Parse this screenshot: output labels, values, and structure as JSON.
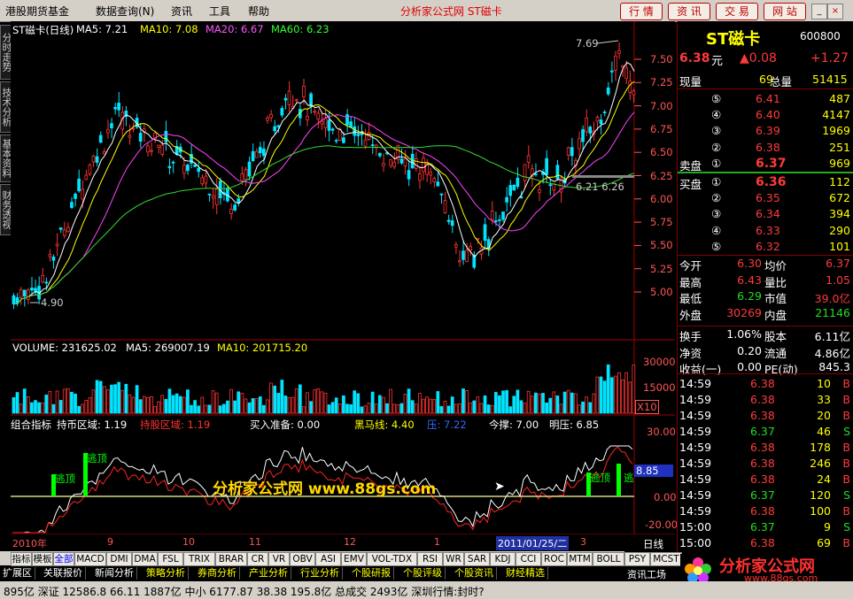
{
  "menu": [
    "港股期货基金",
    "数据查询(N)",
    "资讯",
    "工具",
    "帮助"
  ],
  "window_title": "分析家公式网 ST磁卡",
  "top_buttons": [
    "行 情",
    "资 讯",
    "交 易",
    "网 站"
  ],
  "window_controls": [
    "_",
    "□",
    "×"
  ],
  "left_tabs": [
    "分时走势",
    "技术分析",
    "基本资料",
    "财务透视"
  ],
  "main_header": {
    "name": "ST磁卡(日线)",
    "ma5": "MA5: 7.21",
    "ma10": "MA10: 7.08",
    "ma20": "MA20: 6.67",
    "ma60": "MA60: 6.23"
  },
  "price_axis": [
    "7.50",
    "7.25",
    "7.00",
    "6.75",
    "6.50",
    "6.25",
    "6.00",
    "5.75",
    "5.50",
    "5.25",
    "5.00"
  ],
  "annotations": {
    "high": "7.69",
    "low": "4.90",
    "mid": "6.21 6.26"
  },
  "volume_header": {
    "volume": "VOLUME: 231625.02",
    "ma5": "MA5: 269007.19",
    "ma10": "MA10: 201715.20"
  },
  "volume_axis": [
    "30000",
    "15000",
    "X10"
  ],
  "indicator_header": {
    "name": "组合指标",
    "a": "持币区域: 1.19",
    "b": "持股区域: 1.19",
    "c": "买入准备: 0.00",
    "d": "黑马线: 4.40",
    "e": "压: 7.22",
    "f": "今撑: 7.00",
    "g": "明压: 6.85"
  },
  "indicator_axis": [
    "30.00",
    "8.85",
    "0.00",
    "-20.00"
  ],
  "indicator_marks": [
    "逃顶",
    "逃顶",
    "逃顶",
    "逃"
  ],
  "watermark": "分析家公式网 www.88gs.com",
  "time_axis": [
    "2010年",
    "9",
    "10",
    "11",
    "12",
    "1",
    "2011/01/25/二",
    "3"
  ],
  "period": "日线",
  "stock": {
    "name": "ST磁卡",
    "code": "600800",
    "price": "6.38",
    "unit": "元",
    "change": "▲0.08",
    "change_pct": "+1.27"
  },
  "volume_info": {
    "now_label": "现量",
    "now_value": "69",
    "total_label": "总量",
    "total_value": "51415"
  },
  "sell_orders": [
    {
      "level": "⑤",
      "price": "6.41",
      "vol": "487"
    },
    {
      "level": "④",
      "price": "6.40",
      "vol": "4147"
    },
    {
      "level": "③",
      "price": "6.39",
      "vol": "1969"
    },
    {
      "level": "②",
      "price": "6.38",
      "vol": "251"
    },
    {
      "label": "卖盘",
      "level": "①",
      "price": "6.37",
      "vol": "969"
    }
  ],
  "buy_orders": [
    {
      "label": "买盘",
      "level": "①",
      "price": "6.36",
      "vol": "112"
    },
    {
      "level": "②",
      "price": "6.35",
      "vol": "672"
    },
    {
      "level": "③",
      "price": "6.34",
      "vol": "394"
    },
    {
      "level": "④",
      "price": "6.33",
      "vol": "290"
    },
    {
      "level": "⑤",
      "price": "6.32",
      "vol": "101"
    }
  ],
  "stats": [
    {
      "l1": "今开",
      "v1": "6.30",
      "l2": "均价",
      "v2": "6.37"
    },
    {
      "l1": "最高",
      "v1": "6.43",
      "l2": "量比",
      "v2": "1.05"
    },
    {
      "l1": "最低",
      "v1": "6.29",
      "l2": "市值",
      "v2": "39.0亿"
    },
    {
      "l1": "外盘",
      "v1": "30269",
      "l2": "内盘",
      "v2": "21146"
    }
  ],
  "stats2": [
    {
      "l1": "换手",
      "v1": "1.06%",
      "l2": "股本",
      "v2": "6.11亿"
    },
    {
      "l1": "净资",
      "v1": "0.20",
      "l2": "流通",
      "v2": "4.86亿"
    },
    {
      "l1": "收益(一)",
      "v1": "0.00",
      "l2": "PE(动)",
      "v2": "845.3"
    }
  ],
  "ticks": [
    {
      "t": "14:59",
      "p": "6.38",
      "v": "10",
      "s": "B"
    },
    {
      "t": "14:59",
      "p": "6.38",
      "v": "33",
      "s": "B"
    },
    {
      "t": "14:59",
      "p": "6.38",
      "v": "20",
      "s": "B"
    },
    {
      "t": "14:59",
      "p": "6.37",
      "v": "46",
      "s": "S"
    },
    {
      "t": "14:59",
      "p": "6.38",
      "v": "178",
      "s": "B"
    },
    {
      "t": "14:59",
      "p": "6.38",
      "v": "246",
      "s": "B"
    },
    {
      "t": "14:59",
      "p": "6.38",
      "v": "24",
      "s": "B"
    },
    {
      "t": "14:59",
      "p": "6.37",
      "v": "120",
      "s": "S"
    },
    {
      "t": "14:59",
      "p": "6.38",
      "v": "100",
      "s": "B"
    },
    {
      "t": "15:00",
      "p": "6.37",
      "v": "9",
      "s": "S"
    },
    {
      "t": "15:00",
      "p": "6.38",
      "v": "69",
      "s": "B"
    }
  ],
  "indicator_buttons": [
    "指标",
    "模板",
    "全部",
    "MACD",
    "DMI",
    "DMA",
    "FSL",
    "TRIX",
    "BRAR",
    "CR",
    "VR",
    "OBV",
    "ASI",
    "EMV",
    "VOL-TDX",
    "RSI",
    "WR",
    "SAR",
    "KDJ",
    "CCI",
    "ROC",
    "MTM",
    "BOLL",
    "PSY",
    "MCST"
  ],
  "link_tabs": [
    "扩展区",
    "关联报价",
    "新闻分析",
    "策略分析",
    "券商分析",
    "产业分析",
    "行业分析",
    "个股研报",
    "个股评级",
    "个股资讯",
    "财经精选"
  ],
  "bottom_right_label": "资讯工场",
  "logo_text": {
    "name": "分析家公式网",
    "url": "www.88gs.com"
  },
  "ticker_text": "895亿  深证 12586.8  66.11  1887亿  中小 6177.87  38.38  195.8亿  总成交 2493亿  深圳行情:封时?"
}
